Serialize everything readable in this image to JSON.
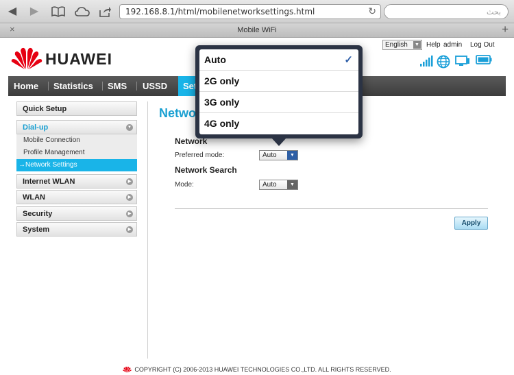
{
  "browser": {
    "url": "192.168.8.1/html/mobilenetworksettings.html",
    "search_placeholder": "بحث",
    "tab_title": "Mobile WiFi"
  },
  "header": {
    "brand": "HUAWEI",
    "language": "English",
    "help": "Help",
    "user": "admin",
    "logout": "Log Out"
  },
  "nav": {
    "items": [
      "Home",
      "Statistics",
      "SMS",
      "USSD",
      "Settings"
    ]
  },
  "sidebar": {
    "quick_setup": "Quick Setup",
    "dialup": "Dial-up",
    "dialup_items": [
      "Mobile Connection",
      "Profile Management",
      "→Network Settings"
    ],
    "internet_wlan": "Internet WLAN",
    "wlan": "WLAN",
    "security": "Security",
    "system": "System"
  },
  "main": {
    "title": "Network Settings",
    "network_section": "Network",
    "preferred_mode_label": "Preferred mode:",
    "preferred_mode_value": "Auto",
    "search_section": "Network Search",
    "mode_label": "Mode:",
    "mode_value": "Auto",
    "apply": "Apply"
  },
  "popover": {
    "options": [
      "Auto",
      "2G only",
      "3G only",
      "4G only"
    ],
    "selected": "Auto",
    "check": "✓"
  },
  "footer": {
    "copyright": "COPYRIGHT (C) 2006-2013 HUAWEI TECHNOLOGIES CO.,LTD. ALL RIGHTS RESERVED."
  },
  "colors": {
    "accent": "#19b4e8",
    "brand_red": "#e60012",
    "nav_bg": "#4a4a4a",
    "popover_bg": "#2b3344"
  }
}
